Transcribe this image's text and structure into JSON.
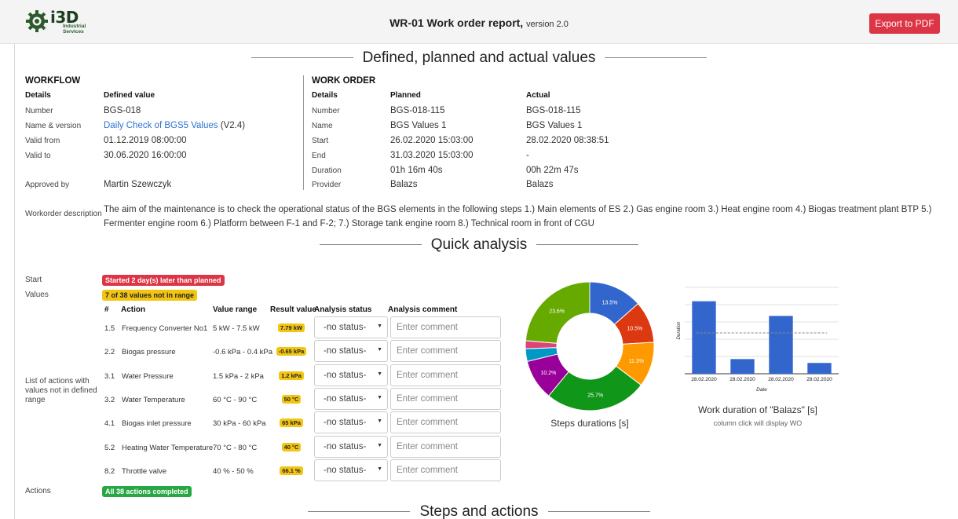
{
  "header": {
    "logo_text": "i3D",
    "logo_sub1": "Industrial",
    "logo_sub2": "Services",
    "title_bold": "WR-01 Work order report,",
    "title_version": "version 2.0",
    "export_label": "Export to PDF"
  },
  "section1": {
    "title": "Defined, planned and actual values"
  },
  "workflow": {
    "title": "WORKFLOW",
    "col_details": "Details",
    "col_defined": "Defined value",
    "rows": [
      {
        "label": "Number",
        "value": "BGS-018"
      },
      {
        "label": "Name & version",
        "value": "Daily Check of BGS5 Values",
        "extra": "(V2.4)"
      },
      {
        "label": "Valid from",
        "value": "01.12.2019 08:00:00"
      },
      {
        "label": "Valid to",
        "value": "30.06.2020 16:00:00"
      },
      {
        "label": "Approved by",
        "value": "Martin Szewczyk"
      }
    ],
    "desc_label": "Workorder description",
    "description": "The aim of the maintenance is to check the operational status of the BGS elements in the following steps 1.) Main elements of ES 2.) Gas engine room 3.) Heat engine room 4.) Biogas treatment plant BTP 5.) Fermenter engine room 6.) Platform between F-1 and F-2; 7.) Storage tank engine room 8.) Technical room in front of CGU"
  },
  "workorder": {
    "title": "WORK ORDER",
    "col_details": "Details",
    "col_planned": "Planned",
    "col_actual": "Actual",
    "rows": [
      {
        "label": "Number",
        "planned": "BGS-018-115",
        "actual": "BGS-018-115"
      },
      {
        "label": "Name",
        "planned": "BGS Values 1",
        "actual": "BGS Values 1"
      },
      {
        "label": "Start",
        "planned": "26.02.2020 15:03:00",
        "actual": "28.02.2020 08:38:51"
      },
      {
        "label": "End",
        "planned": "31.03.2020 15:03:00",
        "actual": "-"
      },
      {
        "label": "Duration",
        "planned": "01h 16m 40s",
        "actual": "00h 22m 47s"
      },
      {
        "label": "Provider",
        "planned": "Balazs",
        "actual": "Balazs"
      }
    ]
  },
  "section2": {
    "title": "Quick analysis"
  },
  "quick": {
    "start_label": "Start",
    "start_badge": "Started 2 day(s) later than planned",
    "values_label": "Values",
    "values_badge": "7 of 38 values not in range",
    "list_label": "List of actions with values not in defined range",
    "actions_label": "Actions",
    "actions_badge": "All 38 actions completed",
    "table_headers": {
      "num": "#",
      "action": "Action",
      "range": "Value range",
      "result": "Result value",
      "status": "Analysis status",
      "comment": "Analysis comment"
    },
    "status_placeholder": "-no status-",
    "comment_placeholder": "Enter comment",
    "rows": [
      {
        "num": "1.5",
        "action": "Frequency Converter No1",
        "range": "5 kW - 7.5 kW",
        "result": "7.79 kW"
      },
      {
        "num": "2.2",
        "action": "Biogas pressure",
        "range": "-0.6 kPa - 0.4 kPa",
        "result": "-0.65 kPa"
      },
      {
        "num": "3.1",
        "action": "Water Pressure",
        "range": "1.5 kPa - 2 kPa",
        "result": "1.2 kPa"
      },
      {
        "num": "3.2",
        "action": "Water Temperature",
        "range": "60 °C - 90 °C",
        "result": "50 °C"
      },
      {
        "num": "4.1",
        "action": "Biogas inlet pressure",
        "range": "30 kPa - 60 kPa",
        "result": "65 kPa"
      },
      {
        "num": "5.2",
        "action": "Heating Water Temperature",
        "range": "70 °C - 80 °C",
        "result": "40 °C"
      },
      {
        "num": "8.2",
        "action": "Throttle valve",
        "range": "40 % - 50 %",
        "result": "66.1 %"
      }
    ]
  },
  "chart_data": [
    {
      "type": "pie",
      "title": "Steps durations [s]",
      "slices": [
        {
          "value": 13.5,
          "label": "13.5%",
          "color": "#3366cc"
        },
        {
          "value": 10.5,
          "label": "10.5%",
          "color": "#dc3912"
        },
        {
          "value": 11.3,
          "label": "11.3%",
          "color": "#ff9900"
        },
        {
          "value": 25.7,
          "label": "25.7%",
          "color": "#109618"
        },
        {
          "value": 10.2,
          "label": "10.2%",
          "color": "#990099"
        },
        {
          "value": 3.2,
          "label": "",
          "color": "#0099c6"
        },
        {
          "value": 2.0,
          "label": "",
          "color": "#dd4477"
        },
        {
          "value": 23.6,
          "label": "23.6%",
          "color": "#66aa00"
        }
      ]
    },
    {
      "type": "bar",
      "title": "Work duration of \"Balazs\" [s]",
      "subtitle": "column click will display WO",
      "xlabel": "Date",
      "ylabel": "Duration",
      "categories": [
        "28.02.2020",
        "28.02.2020",
        "28.02.2020",
        "28.02.2020"
      ],
      "values": [
        470,
        95,
        375,
        70
      ],
      "average": 265,
      "ylim": [
        0,
        560
      ],
      "color": "#3366cc"
    }
  ],
  "section3": {
    "title": "Steps and actions"
  }
}
